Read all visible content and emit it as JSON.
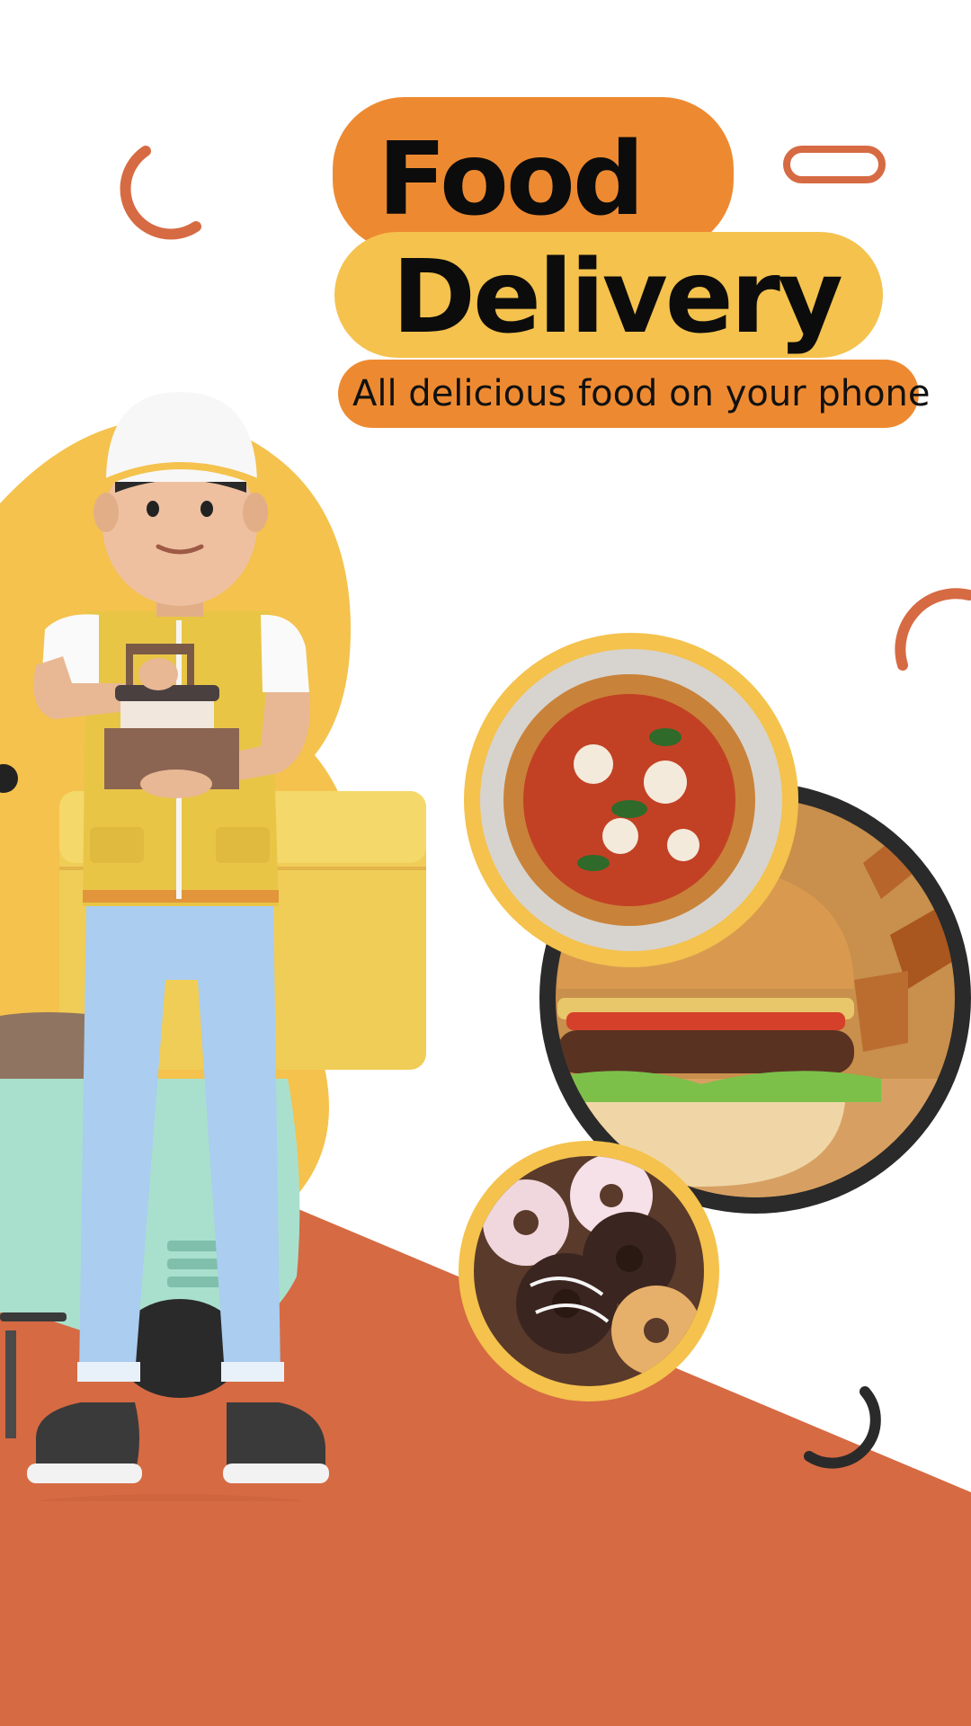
{
  "poster": {
    "title_line1": "Food",
    "title_line2": "Delivery",
    "tagline": "All delicious food on your phone"
  },
  "colors": {
    "orange": "#ed8a31",
    "yellow": "#f4c24d",
    "terracotta": "#d66a43",
    "dark": "#2a2a2a",
    "mint": "#a9e0cd"
  },
  "images": [
    {
      "name": "delivery-man",
      "depicts": "3D courier holding coffee carrier next to scooter"
    },
    {
      "name": "pizza",
      "depicts": "pizza"
    },
    {
      "name": "burger",
      "depicts": "burger and fries"
    },
    {
      "name": "donuts",
      "depicts": "donuts"
    }
  ]
}
